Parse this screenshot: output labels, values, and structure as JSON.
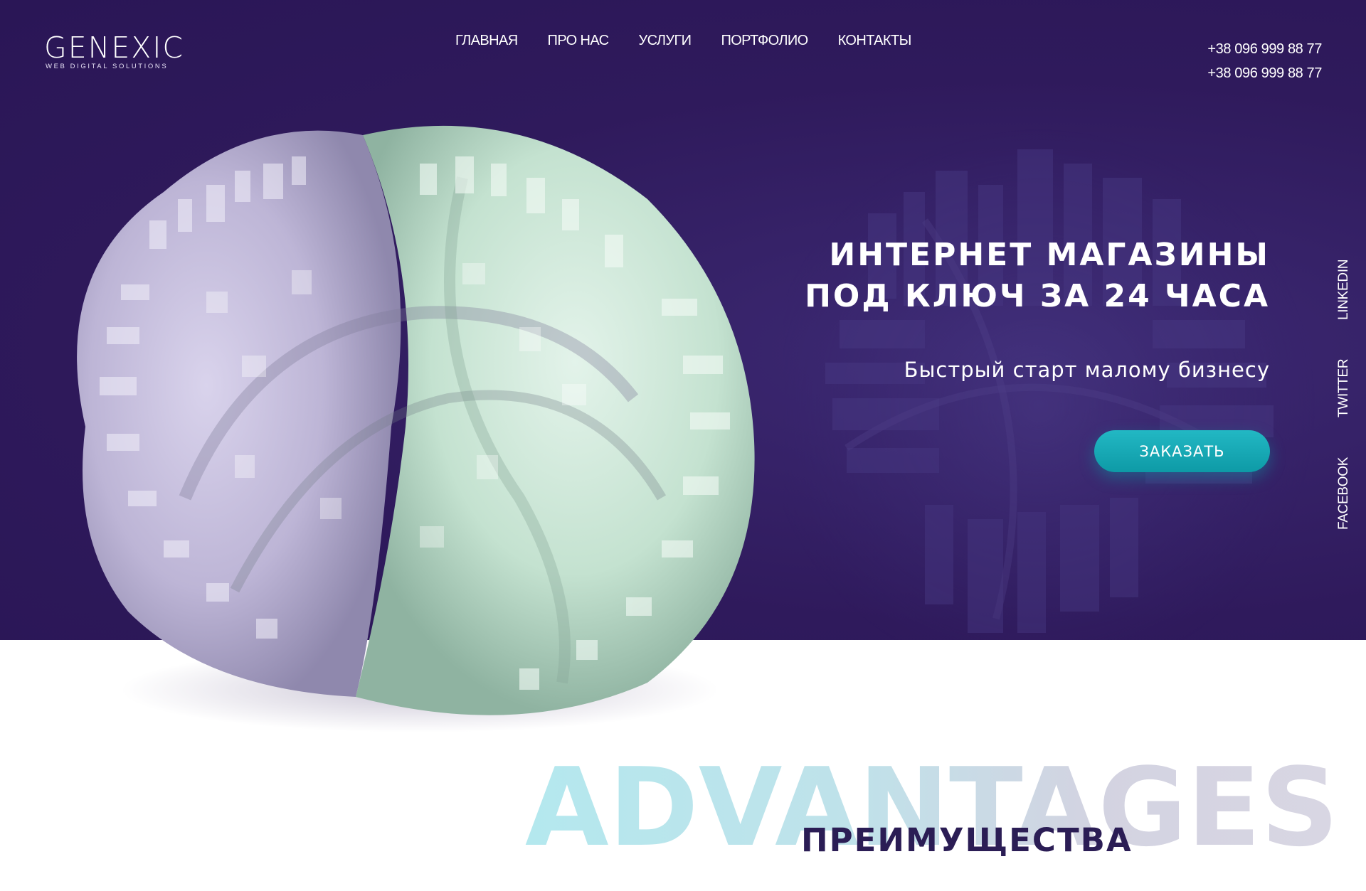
{
  "logo": {
    "word": "GENEXIC",
    "tagline": "WEB DIGITAL SOLUTIONS"
  },
  "nav": [
    {
      "label": "ГЛАВНАЯ"
    },
    {
      "label": "ПРО НАС"
    },
    {
      "label": "УСЛУГИ"
    },
    {
      "label": "ПОРТФОЛИО"
    },
    {
      "label": "КОНТАКТЫ"
    }
  ],
  "phones": [
    "+38 096 999 88 77",
    "+38 096 999 88 77"
  ],
  "hero": {
    "title_line1": "ИНТЕРНЕТ МАГАЗИНЫ",
    "title_line2": "ПОД КЛЮЧ ЗА 24 ЧАСА",
    "subtitle": "Быстрый старт малому бизнесу",
    "cta_label": "ЗАКАЗАТЬ"
  },
  "social": {
    "linkedin": "LINKEDIN",
    "twitter": "TWITTER",
    "facebook": "FACEBOOK"
  },
  "advantages": {
    "watermark": "ADVANTAGES",
    "title": "ПРЕИМУЩЕСТВА"
  },
  "colors": {
    "hero_bg": "#2f1a5c",
    "accent_teal": "#14a8b4",
    "heading_dark": "#2b1d55",
    "sculpture_lavender": "#c9c2df",
    "sculpture_mint": "#c7e6d4"
  }
}
